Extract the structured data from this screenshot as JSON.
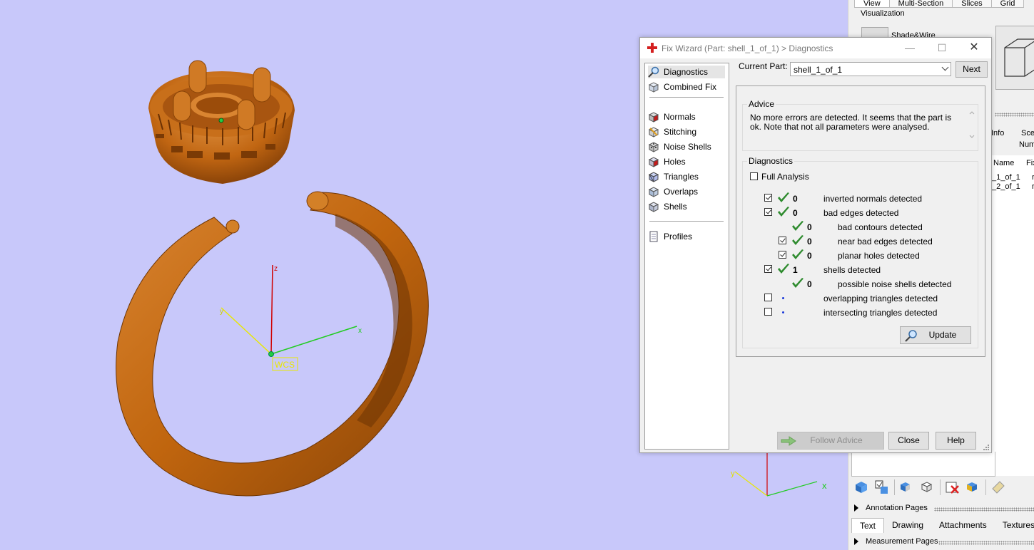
{
  "viewport": {
    "axis_x": "x",
    "axis_y": "y",
    "axis_z": "z",
    "wcs_label": "WCS",
    "mini_axis_x": "x",
    "mini_axis_y": "y"
  },
  "right_panel": {
    "tabs": [
      "View",
      "Multi-Section",
      "Slices",
      "Grid"
    ],
    "visualization_label": "Visualization",
    "shade_label": "Shade&Wire",
    "info_label": "Info",
    "scene_label": "Scer",
    "number_label": "Numb",
    "col_name": "Name",
    "col_fix": "Fix",
    "rows": [
      "_1_of_1",
      "_2_of_1"
    ],
    "row_tail": [
      "r",
      "r"
    ],
    "annotation_pages": "Annotation Pages",
    "bottom_tabs": [
      "Text",
      "Drawing",
      "Attachments",
      "Textures"
    ],
    "measurement_pages": "Measurement Pages"
  },
  "dialog": {
    "title": "Fix Wizard (Part: shell_1_of_1) > Diagnostics",
    "nav": [
      {
        "label": "Diagnostics",
        "icon": "magnifier-icon",
        "selected": true
      },
      {
        "label": "Combined Fix",
        "icon": "combined-fix-icon"
      },
      {
        "label": "Normals",
        "icon": "normals-cube-icon"
      },
      {
        "label": "Stitching",
        "icon": "stitching-cube-icon"
      },
      {
        "label": "Noise Shells",
        "icon": "noise-shells-cube-icon"
      },
      {
        "label": "Holes",
        "icon": "holes-cube-icon"
      },
      {
        "label": "Triangles",
        "icon": "triangles-cube-icon"
      },
      {
        "label": "Overlaps",
        "icon": "overlaps-cube-icon"
      },
      {
        "label": "Shells",
        "icon": "shells-cube-icon"
      },
      {
        "label": "Profiles",
        "icon": "profiles-icon"
      }
    ],
    "current_part_label": "Current Part:",
    "current_part_value": "shell_1_of_1",
    "next_button": "Next",
    "advice_title": "Advice",
    "advice_text": "No more errors are detected. It seems that the part is ok. Note that not all parameters were analysed.",
    "diagnostics_title": "Diagnostics",
    "full_analysis_label": "Full Analysis",
    "full_analysis_checked": false,
    "rows": [
      {
        "checkbox": true,
        "checked": true,
        "status": "ok",
        "count": "0",
        "label": "inverted normals detected",
        "indent": 0
      },
      {
        "checkbox": true,
        "checked": true,
        "status": "ok",
        "count": "0",
        "label": "bad edges detected",
        "indent": 0
      },
      {
        "checkbox": false,
        "checked": false,
        "status": "ok",
        "count": "0",
        "label": "bad contours detected",
        "indent": 1
      },
      {
        "checkbox": true,
        "checked": true,
        "status": "ok",
        "count": "0",
        "label": "near bad edges detected",
        "indent": 1
      },
      {
        "checkbox": true,
        "checked": true,
        "status": "ok",
        "count": "0",
        "label": "planar holes detected",
        "indent": 1
      },
      {
        "checkbox": true,
        "checked": true,
        "status": "ok",
        "count": "1",
        "label": "shells detected",
        "indent": 0
      },
      {
        "checkbox": false,
        "checked": false,
        "status": "ok",
        "count": "0",
        "label": "possible noise shells detected",
        "indent": 1
      },
      {
        "checkbox": true,
        "checked": false,
        "status": "pending",
        "count": "",
        "label": "overlapping triangles detected",
        "indent": 0
      },
      {
        "checkbox": true,
        "checked": false,
        "status": "pending",
        "count": "",
        "label": "intersecting triangles detected",
        "indent": 0
      }
    ],
    "update_button": "Update",
    "follow_advice_button": "Follow Advice",
    "close_button": "Close",
    "help_button": "Help",
    "colors": {
      "check_green": "#2e8b2e",
      "pending_dot": "#1a39d9",
      "model_orange": "#c0650e"
    }
  }
}
